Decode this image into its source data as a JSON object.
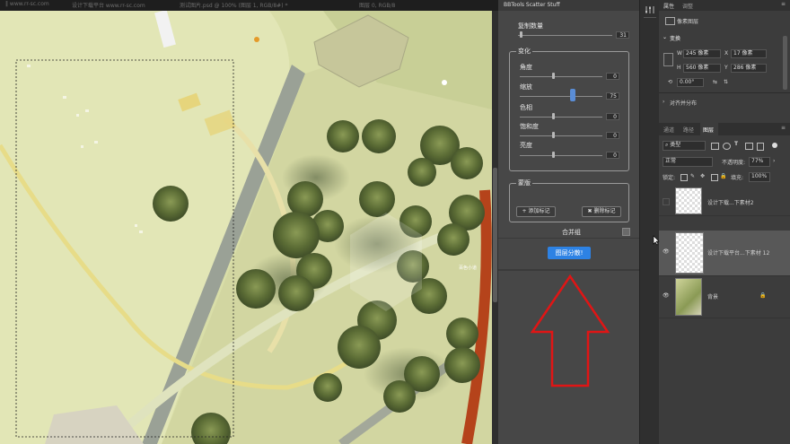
{
  "title_bar": {
    "segment1": "‖ www.rr-sc.com",
    "segment2": "设计下载平台 www.rr-sc.com",
    "segment3": "测试图片.psd @ 100% (图层 1, RGB/8#) *",
    "segment4": "图层 0, RGB/8"
  },
  "canvas": {
    "label_text": "百色小道"
  },
  "plugin": {
    "title": "BBTools Scatter Stuff",
    "copies_label": "复制数量",
    "copies_value": "31",
    "variation_title": "变化",
    "angle_label": "角度",
    "angle_value": "0",
    "scale_label": "缩放",
    "scale_value": "75",
    "hue_label": "色相",
    "hue_value": "0",
    "saturation_label": "饱和度",
    "saturation_value": "0",
    "brightness_label": "亮度",
    "brightness_value": "0",
    "mask_title": "蒙版",
    "add_mark_button": "+ 添加标记",
    "delete_mark_button": "✖ 删除标记",
    "merge_label": "合并组",
    "scatter_button": "图层分散!"
  },
  "properties": {
    "tab_props": "属性",
    "tab_adjust": "调整",
    "pixel_layer": "像素图层",
    "transform_title": "变换",
    "w_label": "W",
    "w_value": "245 像素",
    "x_label": "X",
    "x_value": "17 像素",
    "h_label": "H",
    "h_value": "560 像素",
    "y_label": "Y",
    "y_value": "286 像素",
    "angle_value": "0.00°",
    "align_title": "对齐并分布"
  },
  "layers": {
    "tab_channels": "通道",
    "tab_paths": "路径",
    "tab_layers": "图层",
    "filter_kind": "类型",
    "blend_mode": "正常",
    "opacity_label": "不透明度:",
    "opacity_value": "77%",
    "lock_label": "锁定:",
    "fill_label": "填充:",
    "fill_value": "100%",
    "items": [
      {
        "name": "设计下载...下素材2"
      },
      {
        "name": "设计下载平台...下素材 12"
      },
      {
        "name": "背景"
      }
    ]
  },
  "watermark": "www.rr-sc.com",
  "colors": {
    "accent": "#2d82e4",
    "arrow": "#e01515"
  }
}
